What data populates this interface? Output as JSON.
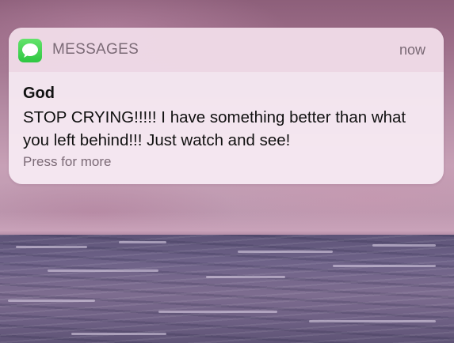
{
  "notification": {
    "app_name": "MESSAGES",
    "app_icon": "messages-icon",
    "timestamp": "now",
    "sender": "God",
    "message": "STOP CRYING!!!!! I have something better than what you left behind!!! Just watch and see!",
    "hint": "Press for more"
  },
  "colors": {
    "icon_green": "#34c759",
    "card_background": "#f8ecf4",
    "header_background": "#ecd6e4",
    "secondary_text": "#7b6a76",
    "primary_text": "#111111"
  }
}
